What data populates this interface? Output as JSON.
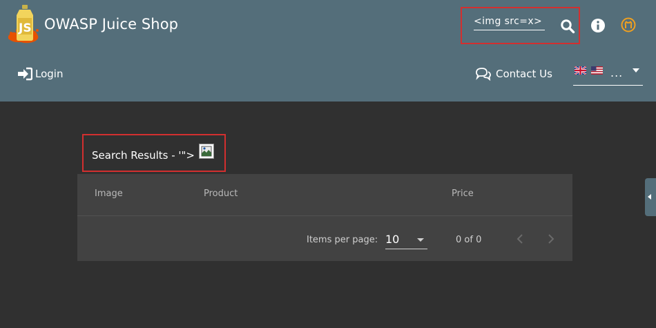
{
  "header": {
    "app_title": "OWASP Juice Shop",
    "search_value": "<img src=x>",
    "login_label": "Login",
    "contact_label": "Contact Us",
    "language_more": "...",
    "icons": [
      "juice-shop-logo",
      "search-icon",
      "info-icon",
      "github-icon",
      "login-icon",
      "chat-icon",
      "flag-gb-icon",
      "flag-us-icon",
      "chevron-down-icon"
    ]
  },
  "main": {
    "results_heading": "Search Results - '\">",
    "table": {
      "columns": [
        "Image",
        "Product",
        "Price"
      ],
      "rows": []
    },
    "paginator": {
      "items_per_page_label": "Items per page:",
      "items_per_page_value": "10",
      "range_label": "0 of 0"
    }
  },
  "colors": {
    "toolbar": "#546e7a",
    "background": "#303030",
    "card": "#424242",
    "highlight_border": "#d32f2f"
  }
}
